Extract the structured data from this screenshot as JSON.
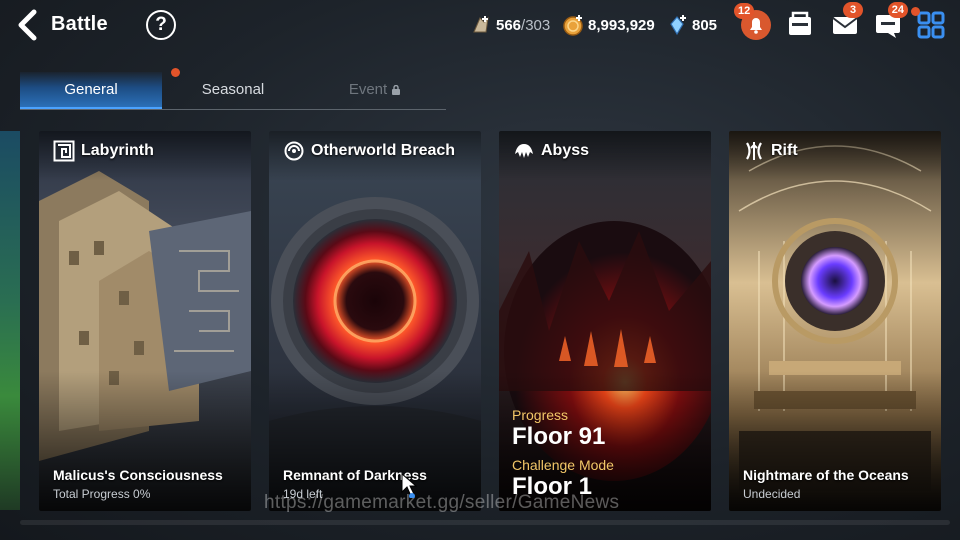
{
  "header": {
    "title": "Battle",
    "back_icon": "chevron-left-icon",
    "help_label": "?"
  },
  "resources": {
    "stamina": {
      "value": "566",
      "max": "/303",
      "icon": "stamina-icon"
    },
    "gold": {
      "value": "8,993,929",
      "icon": "gold-coin-icon"
    },
    "crystal": {
      "value": "805",
      "icon": "crystal-icon"
    }
  },
  "top_icons": {
    "notifications": {
      "icon": "bell-icon",
      "badge": "12"
    },
    "shop": {
      "icon": "shop-icon"
    },
    "mail": {
      "icon": "mail-icon",
      "badge": "3"
    },
    "chat": {
      "icon": "chat-icon",
      "badge": "24"
    },
    "menu": {
      "icon": "grid-menu-icon"
    }
  },
  "tabs": [
    {
      "label": "General",
      "active": true
    },
    {
      "label": "Seasonal",
      "active": false,
      "has_dot": true
    },
    {
      "label": "Event",
      "active": false,
      "locked": true
    }
  ],
  "cards": [
    {
      "name": "Labyrinth",
      "icon": "labyrinth-icon",
      "footer_title": "Malicus's Consciousness",
      "footer_sub": "Total Progress 0%"
    },
    {
      "name": "Otherworld Breach",
      "icon": "portal-icon",
      "footer_title": "Remnant of Darkness",
      "footer_sub": "19d left"
    },
    {
      "name": "Abyss",
      "icon": "abyss-icon",
      "progress_label": "Progress",
      "progress_value": "Floor 91",
      "challenge_label": "Challenge Mode",
      "challenge_value": "Floor 1"
    },
    {
      "name": "Rift",
      "icon": "rift-icon",
      "footer_title": "Nightmare of the Oceans",
      "footer_sub": "Undecided"
    }
  ],
  "watermark": "https://gamemarket.gg/seller/GameNews",
  "colors": {
    "accent_blue": "#2b70b8",
    "badge_orange": "#e2542a",
    "abyss_label": "#f2c768"
  }
}
